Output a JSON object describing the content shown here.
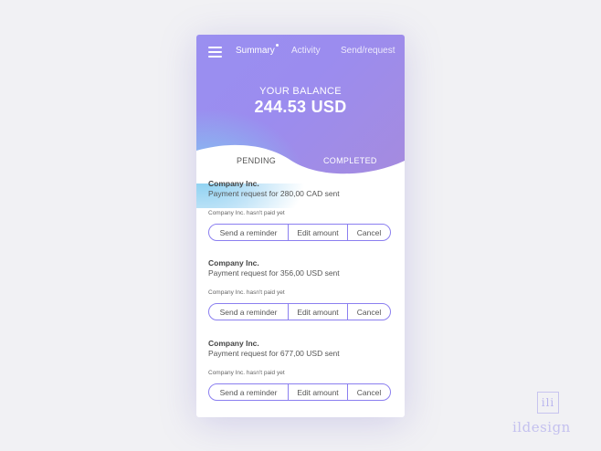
{
  "nav": {
    "tabs": [
      {
        "label": "Summary",
        "active": true
      },
      {
        "label": "Activity",
        "active": false
      },
      {
        "label": "Send/request",
        "active": false
      }
    ]
  },
  "balance": {
    "label": "YOUR BALANCE",
    "amount": "244.53 USD"
  },
  "subtabs": {
    "pending": "PENDING",
    "completed": "COMPLETED"
  },
  "requests": [
    {
      "company": "Company Inc.",
      "description": "Payment request for 280,00 CAD sent",
      "status": "Company Inc. hasn't paid yet",
      "actions": {
        "remind": "Send a reminder",
        "edit": "Edit amount",
        "cancel": "Cancel"
      }
    },
    {
      "company": "Company Inc.",
      "description": "Payment request for 356,00 USD sent",
      "status": "Company Inc. hasn't paid yet",
      "actions": {
        "remind": "Send a reminder",
        "edit": "Edit amount",
        "cancel": "Cancel"
      }
    },
    {
      "company": "Company Inc.",
      "description": "Payment request for 677,00 USD sent",
      "status": "Company Inc. hasn't paid yet",
      "actions": {
        "remind": "Send a reminder",
        "edit": "Edit amount",
        "cancel": "Cancel"
      }
    }
  ],
  "branding": {
    "mark": "ili",
    "name": "ildesign"
  },
  "colors": {
    "accent": "#8b7ff0",
    "gradient_start": "#9a8ff0",
    "gradient_end": "#a58bde",
    "glow": "#82cdf0"
  }
}
